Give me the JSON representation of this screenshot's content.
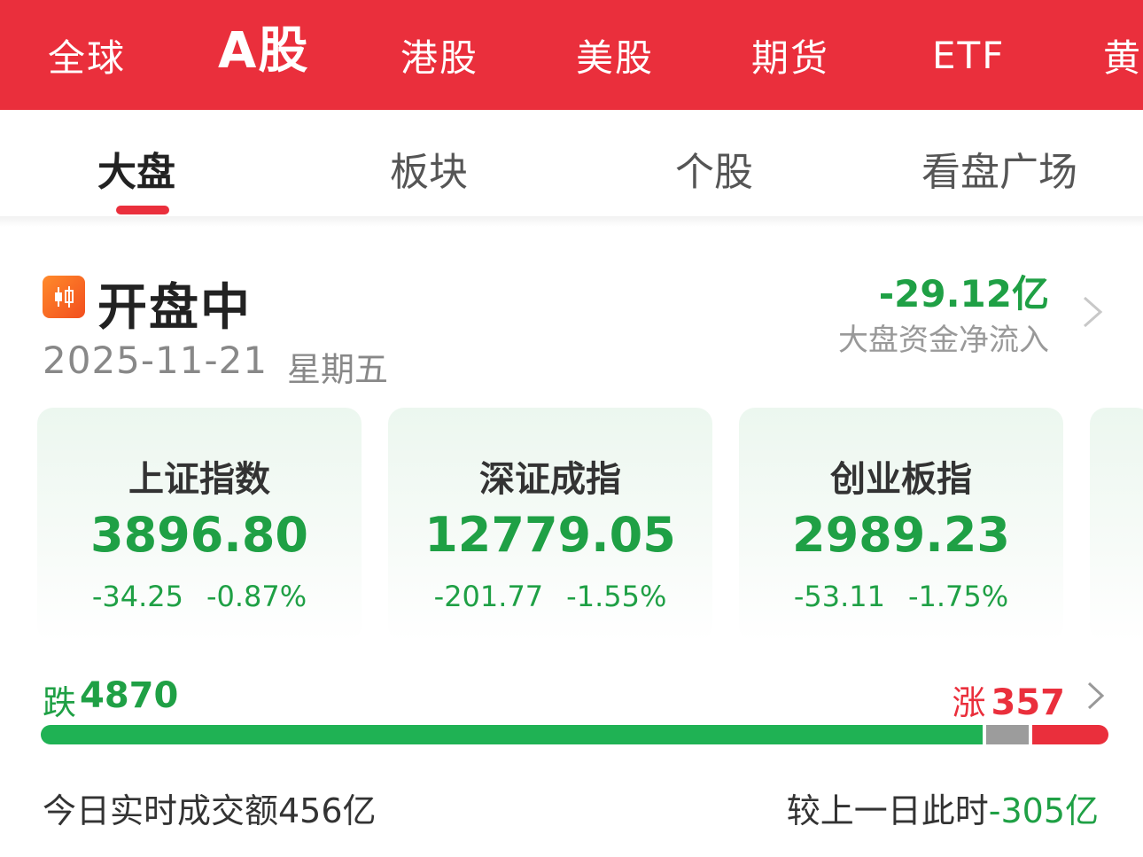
{
  "market_tabs": [
    {
      "label": "全球",
      "active": false
    },
    {
      "label": "A股",
      "active": true
    },
    {
      "label": "港股",
      "active": false
    },
    {
      "label": "美股",
      "active": false
    },
    {
      "label": "期货",
      "active": false
    },
    {
      "label": "ETF",
      "active": false
    },
    {
      "label": "黄",
      "active": false
    }
  ],
  "sub_tabs": [
    {
      "label": "大盘",
      "active": true
    },
    {
      "label": "板块",
      "active": false
    },
    {
      "label": "个股",
      "active": false
    },
    {
      "label": "看盘广场",
      "active": false
    }
  ],
  "status": {
    "title": "开盘中",
    "date": "2025-11-21",
    "weekday": "星期五",
    "flow_value": "-29.12亿",
    "flow_label": "大盘资金净流入"
  },
  "indices": [
    {
      "name": "上证指数",
      "value": "3896.80",
      "change": "-34.25",
      "pct": "-0.87%"
    },
    {
      "name": "深证成指",
      "value": "12779.05",
      "change": "-201.77",
      "pct": "-1.55%"
    },
    {
      "name": "创业板指",
      "value": "2989.23",
      "change": "-53.11",
      "pct": "-1.75%"
    }
  ],
  "breadth": {
    "fall_label": "跌",
    "fall_count": "4870",
    "rise_label": "涨",
    "rise_count": "357",
    "fall_share": 0.888,
    "flat_share": 0.04,
    "rise_share": 0.072
  },
  "turnover": {
    "text": "今日实时成交额456亿",
    "compare_label": "较上一日此时",
    "compare_delta": "-305亿"
  },
  "colors": {
    "brand_red": "#ea2f3c",
    "fall_green": "#1fa045",
    "flat_gray": "#9c9c9c"
  }
}
